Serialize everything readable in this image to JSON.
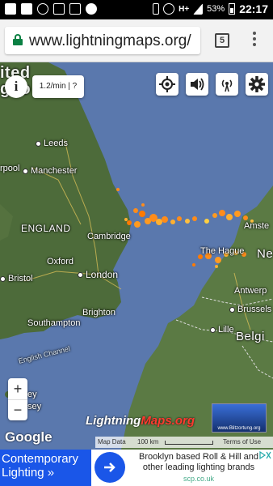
{
  "status_bar": {
    "network": "H+",
    "battery": "53%",
    "time": "22:17"
  },
  "browser": {
    "url": "www.lightningmaps.org/",
    "tab_count": "5"
  },
  "map": {
    "rate": "1.2/min | ?",
    "info_label": "i",
    "zoom_in": "+",
    "zoom_out": "−",
    "labels": {
      "leeds": "Leeds",
      "liverpool": "rpool",
      "manchester": "Manchester",
      "england": "ENGLAND",
      "cambridge": "Cambridge",
      "oxford": "Oxford",
      "london": "London",
      "bristol": "Bristol",
      "brighton": "Brighton",
      "southampton": "Southampton",
      "channel": "English Channel",
      "amsterdam": "Amste",
      "hague": "The Hague",
      "ne": "Ne",
      "antwerp": "Antwerp",
      "brussels": "Brussels",
      "lille": "Lille",
      "belgium": "Belgi",
      "united": "ited",
      "kingdom": "gdo",
      "jersey_1": "ey",
      "jersey_2": "sey"
    },
    "brand_part1": "Lightning",
    "brand_part2": "Maps.org",
    "blitz_label": "www.Blitzortung.org",
    "google": "Google",
    "attribution_map_data": "Map Data",
    "attribution_scale": "100 km",
    "attribution_terms": "Terms of Use"
  },
  "ad": {
    "title": "Contemporary Lighting »",
    "text": "Brooklyn based Roll & Hill and other leading lighting brands",
    "url": "scp.co.uk"
  },
  "colors": {
    "sea": "#5a78ad",
    "land": "#4d6b3a",
    "accent": "#1a56e8",
    "strike": "#ff8c1a"
  }
}
